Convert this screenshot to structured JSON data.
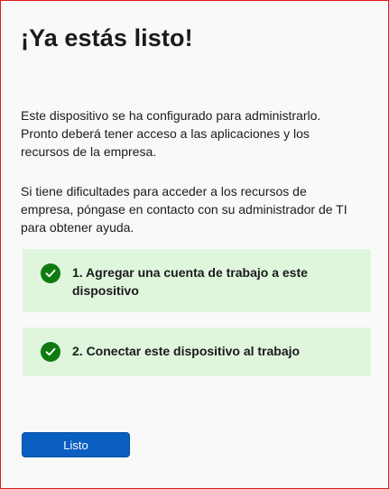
{
  "title": "¡Ya estás listo!",
  "paragraphs": {
    "device_configured": "Este dispositivo se ha configurado para administrarlo. Pronto deberá tener acceso a las aplicaciones y los recursos de la empresa.",
    "help": "Si tiene dificultades para acceder a los recursos de empresa, póngase en contacto con su administrador de TI para obtener ayuda."
  },
  "steps": [
    {
      "label": "1. Agregar una cuenta de trabajo a este dispositivo",
      "status": "completed",
      "icon": "checkmark-circle-icon"
    },
    {
      "label": "2. Conectar este dispositivo al trabajo",
      "status": "completed",
      "icon": "checkmark-circle-icon"
    }
  ],
  "buttons": {
    "done_label": "Listo"
  },
  "colors": {
    "accent": "#0a5fc0",
    "success": "#0f7b0f",
    "success_background": "#dff6dd",
    "frame_border": "#e11a1a"
  }
}
